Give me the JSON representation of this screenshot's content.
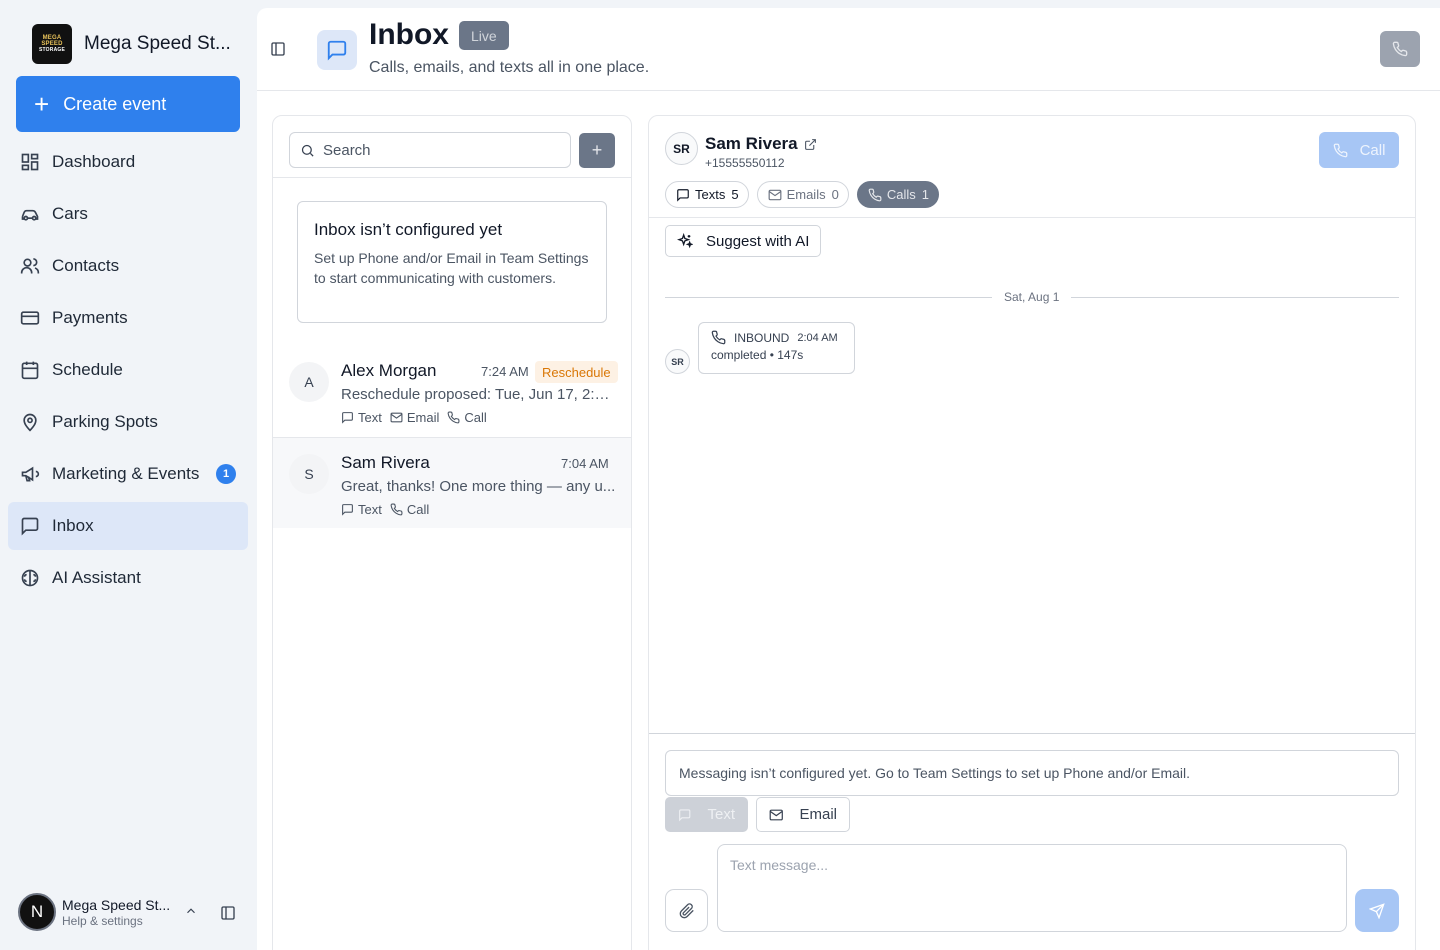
{
  "sidebar": {
    "brand_name": "Mega Speed St...",
    "brand_logo_text": [
      "MEGA SPEED",
      "STORAGE"
    ],
    "create_label": "Create event",
    "items": [
      {
        "label": "Dashboard",
        "icon": "dashboard-icon"
      },
      {
        "label": "Cars",
        "icon": "car-icon"
      },
      {
        "label": "Contacts",
        "icon": "users-icon"
      },
      {
        "label": "Payments",
        "icon": "card-icon"
      },
      {
        "label": "Schedule",
        "icon": "calendar-icon"
      },
      {
        "label": "Parking Spots",
        "icon": "map-pin-icon"
      },
      {
        "label": "Marketing & Events",
        "icon": "megaphone-icon",
        "badge": "1"
      },
      {
        "label": "Inbox",
        "icon": "message-square-icon",
        "active": true
      },
      {
        "label": "AI Assistant",
        "icon": "brain-icon"
      }
    ],
    "user": {
      "initial": "N",
      "name": "Mega Speed St...",
      "sub": "Help & settings"
    }
  },
  "header": {
    "title": "Inbox",
    "badge": "Live",
    "subtitle": "Calls, emails, and texts all in one place."
  },
  "list": {
    "search_placeholder": "Search",
    "add_label": "+",
    "notice": {
      "title": "Inbox isn’t configured yet",
      "body": "Set up Phone and/or Email in Team Settings to start communicating with customers."
    },
    "conversations": [
      {
        "initial": "A",
        "name": "Alex Morgan",
        "time": "7:24 AM",
        "badge": "Reschedule",
        "preview": "Reschedule proposed: Tue, Jun 17, 2:00 ...",
        "channels": [
          "Text",
          "Email",
          "Call"
        ]
      },
      {
        "initial": "S",
        "name": "Sam Rivera",
        "time": "7:04 AM",
        "preview": "Great, thanks! One more thing — any u...",
        "channels": [
          "Text",
          "Call"
        ]
      }
    ]
  },
  "detail": {
    "initials": "SR",
    "name": "Sam Rivera",
    "phone": "+15555550112",
    "call_label": "Call",
    "filters": [
      {
        "label": "Texts",
        "count": "5"
      },
      {
        "label": "Emails",
        "count": "0"
      },
      {
        "label": "Calls",
        "count": "1"
      }
    ],
    "suggest_label": "Suggest with AI",
    "date": "Sat, Aug 1",
    "call_event": {
      "direction": "INBOUND",
      "time": "2:04 AM",
      "status": "completed • 147s"
    },
    "composer": {
      "warning": "Messaging isn’t configured yet. Go to Team Settings to set up Phone and/or Email.",
      "text_label": "Text",
      "email_label": "Email",
      "placeholder": "Text message..."
    }
  },
  "colors": {
    "accent": "#2f80ed",
    "active_nav": "#dde7f8",
    "reschedule": "#d97706"
  }
}
